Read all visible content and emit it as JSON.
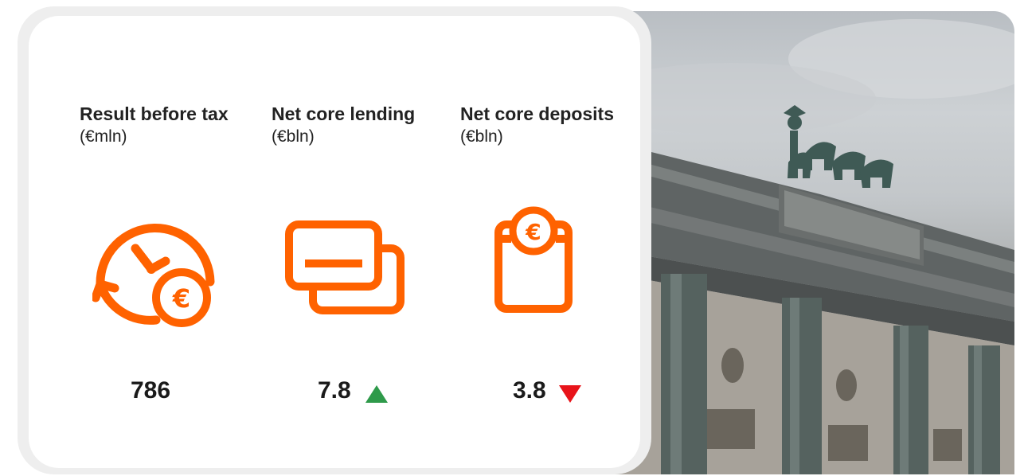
{
  "metrics": [
    {
      "title": "Result before tax",
      "unit": "(€mln)",
      "value": "786",
      "icon": "clock-euro-icon",
      "trend": ""
    },
    {
      "title": "Net core lending",
      "unit": "(€bln)",
      "value": "7.8",
      "icon": "cards-icon",
      "trend": "up"
    },
    {
      "title": "Net core deposits",
      "unit": "(€bln)",
      "value": "3.8",
      "icon": "piggy-jar-euro-icon",
      "trend": "down"
    }
  ],
  "icon_glyph": "€",
  "colors": {
    "accent": "#ff6200",
    "up": "#2e9a4a",
    "down": "#e8141a",
    "card": "#ffffff"
  }
}
